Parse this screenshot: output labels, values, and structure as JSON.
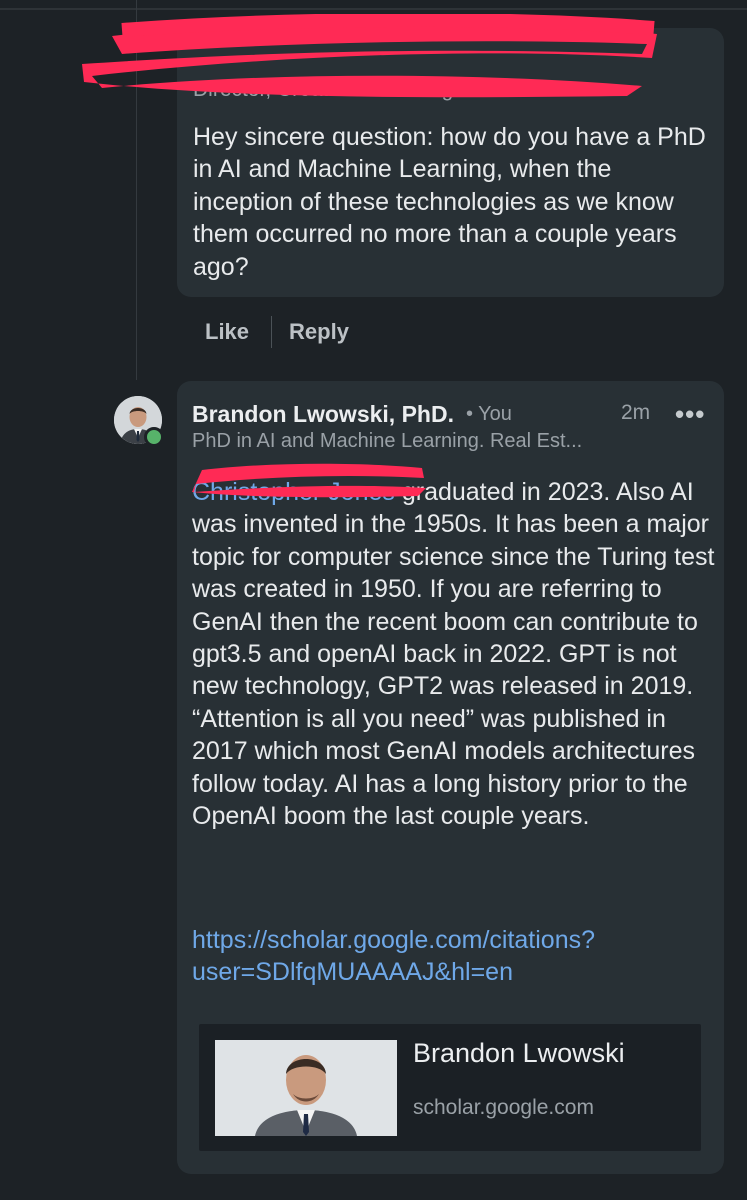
{
  "comment1": {
    "subtitle": "Director, Creative Marketing Produc...",
    "text": "Hey sincere question: how do you have a PhD in AI and Machine Learning, when the inception of these technologies as we know them occurred no more than a couple years ago?",
    "like_label": "Like",
    "reply_label": "Reply"
  },
  "comment2": {
    "author": "Brandon Lwowski, PhD.",
    "relation": "• You",
    "time": "2m",
    "more": "•••",
    "headline": "PhD in AI and Machine Learning. Real Est...",
    "mention": "Christopher Jones",
    "text": " graduated in 2023. Also AI was invented in the 1950s. It has been a major topic for computer science since the Turing test was created in 1950. If you are referring to GenAI then the recent boom can contribute to gpt3.5 and openAI back in 2022. GPT is not new technology, GPT2 was released in 2019. “Attention is all you need” was published in 2017 which most GenAI models architectures follow today. AI has a long history prior to the OpenAI boom the last couple years.",
    "link": "https://scholar.google.com/citations?user=SDlfqMUAAAAJ&hl=en"
  },
  "preview": {
    "title": "Brandon Lwowski",
    "domain": "scholar.google.com"
  },
  "colors": {
    "background": "#1d2226",
    "bubble": "#283035",
    "link": "#6fa8e8",
    "redaction": "#ff2a55",
    "online": "#57b36a"
  }
}
